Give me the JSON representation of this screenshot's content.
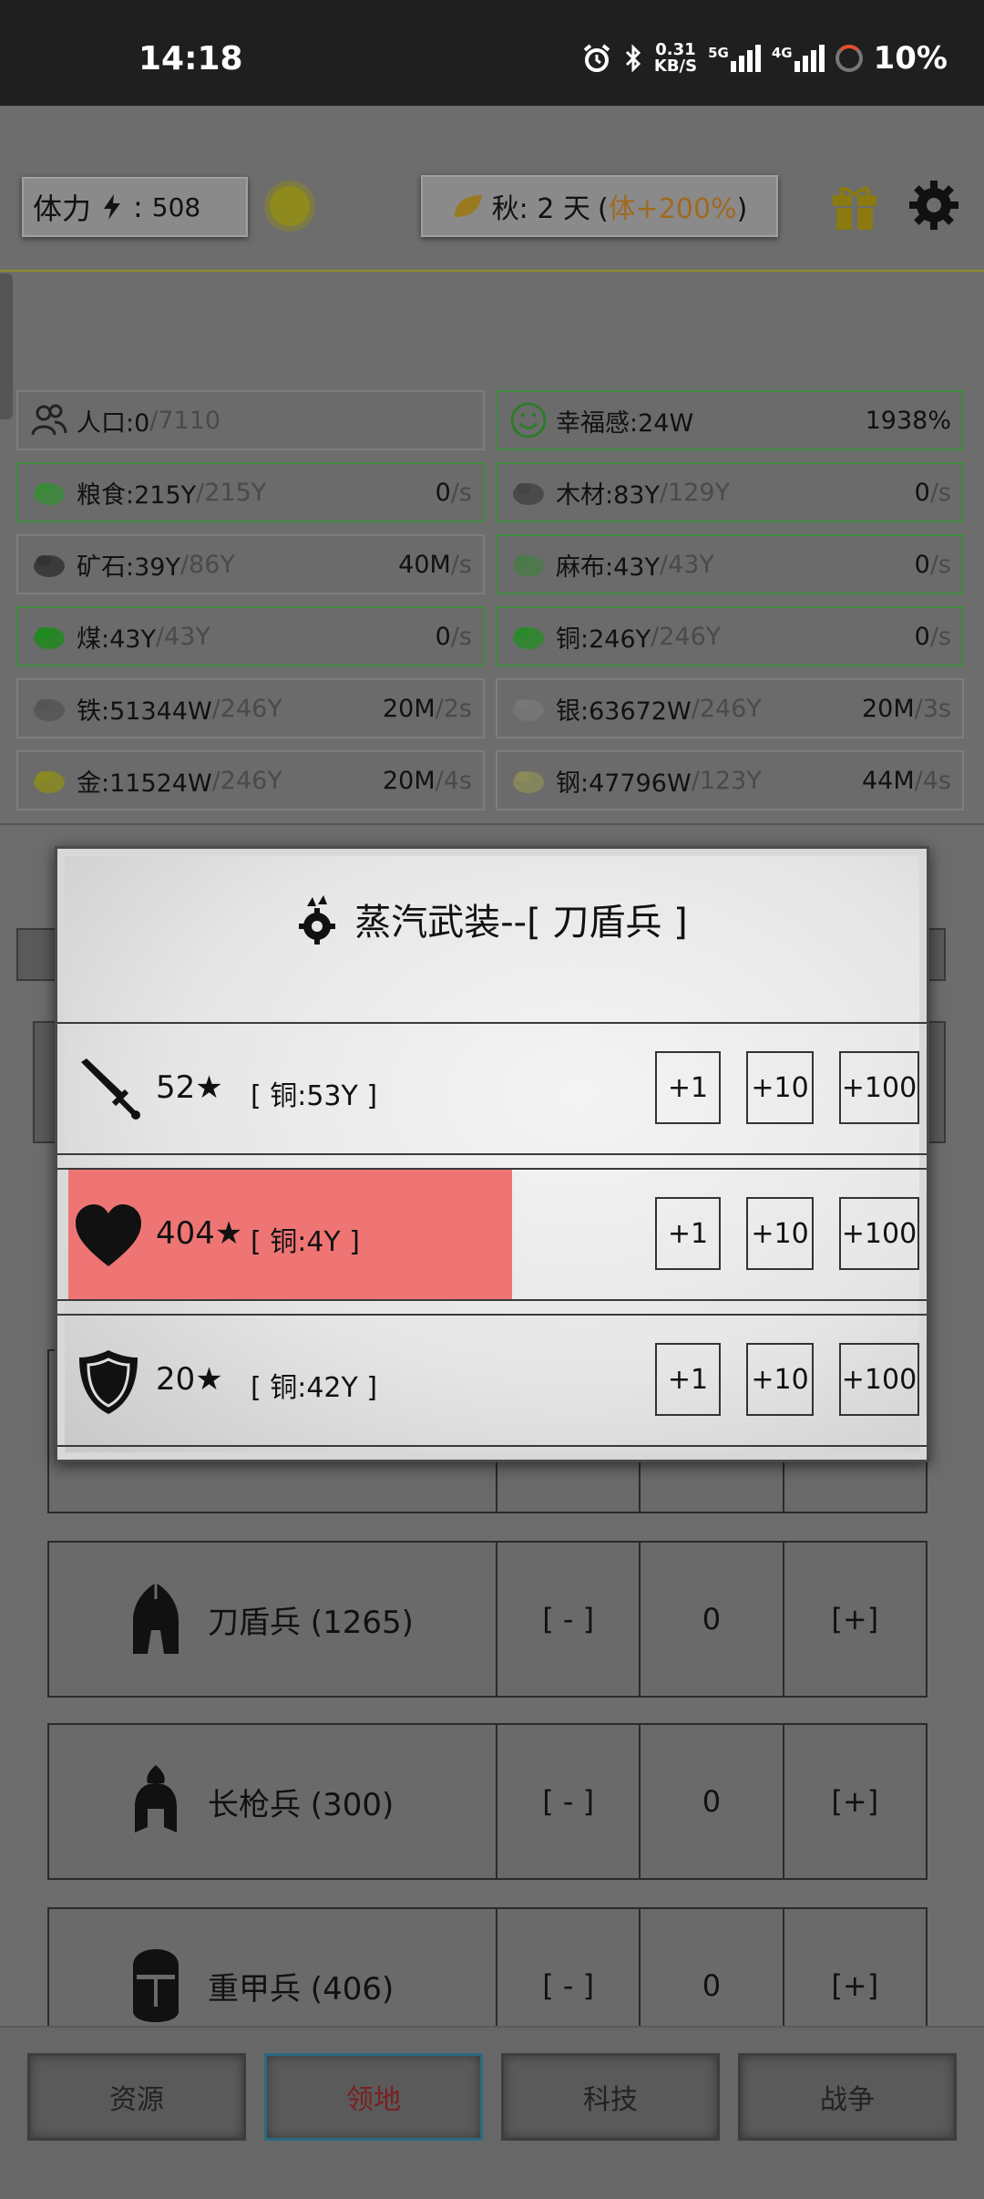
{
  "status_bar": {
    "time": "14:18",
    "net_speed_value": "0.31",
    "net_speed_unit": "KB/S",
    "net_5g": "5G",
    "net_4g": "4G",
    "battery": "10%"
  },
  "header": {
    "stamina_label": "体力",
    "stamina_sep": ":",
    "stamina_value": "508",
    "season_text": "秋: 2 天",
    "season_open": "(",
    "season_bonus": "体+200%",
    "season_close": ")"
  },
  "resources": [
    {
      "name": "人口:0",
      "cap": "/7110",
      "rate": "",
      "unit": "",
      "icon": "people-icon"
    },
    {
      "name": "幸福感:24W",
      "cap": "",
      "rate": "1938%",
      "unit": "",
      "icon": "smile-icon"
    },
    {
      "name": "粮食:215Y",
      "cap": "/215Y",
      "rate": "0",
      "unit": "/s",
      "icon": "food-icon"
    },
    {
      "name": "木材:83Y",
      "cap": "/129Y",
      "rate": "0",
      "unit": "/s",
      "icon": "wood-icon"
    },
    {
      "name": "矿石:39Y",
      "cap": "/86Y",
      "rate": "40M",
      "unit": "/s",
      "icon": "ore-icon"
    },
    {
      "name": "麻布:43Y",
      "cap": "/43Y",
      "rate": "0",
      "unit": "/s",
      "icon": "cloth-icon"
    },
    {
      "name": "煤:43Y",
      "cap": "/43Y",
      "rate": "0",
      "unit": "/s",
      "icon": "coal-icon"
    },
    {
      "name": "铜:246Y",
      "cap": "/246Y",
      "rate": "0",
      "unit": "/s",
      "icon": "copper-icon"
    },
    {
      "name": "铁:51344W",
      "cap": "/246Y",
      "rate": "20M",
      "unit": "/2s",
      "icon": "iron-icon"
    },
    {
      "name": "银:63672W",
      "cap": "/246Y",
      "rate": "20M",
      "unit": "/3s",
      "icon": "silver-icon"
    },
    {
      "name": "金:11524W",
      "cap": "/246Y",
      "rate": "20M",
      "unit": "/4s",
      "icon": "gold-icon"
    },
    {
      "name": "钢:47796W",
      "cap": "/123Y",
      "rate": "44M",
      "unit": "/4s",
      "icon": "steel-icon"
    }
  ],
  "units": [
    {
      "name": "刀盾兵 (1265)",
      "minus": "[ - ]",
      "count": "0",
      "plus": "[+]",
      "icon": "knight-helmet-icon"
    },
    {
      "name": "长枪兵 (300)",
      "minus": "[ - ]",
      "count": "0",
      "plus": "[+]",
      "icon": "spartan-helmet-icon"
    },
    {
      "name": "重甲兵 (406)",
      "minus": "[ - ]",
      "count": "0",
      "plus": "[+]",
      "icon": "great-helm-icon"
    }
  ],
  "nav": [
    "资源",
    "领地",
    "科技",
    "战争"
  ],
  "modal": {
    "title": "蒸汽武装--[ 刀盾兵 ]",
    "rows": [
      {
        "stars": "52★",
        "price": "[ 铜:53Y ]",
        "icon": "sword-icon",
        "progress": 0
      },
      {
        "stars": "404★",
        "price": "[ 铜:4Y ]",
        "icon": "heart-icon",
        "progress": 0.52
      },
      {
        "stars": "20★",
        "price": "[ 铜:42Y ]",
        "icon": "shield-icon",
        "progress": 0
      }
    ],
    "buttons": [
      "+1",
      "+10",
      "+100"
    ]
  }
}
